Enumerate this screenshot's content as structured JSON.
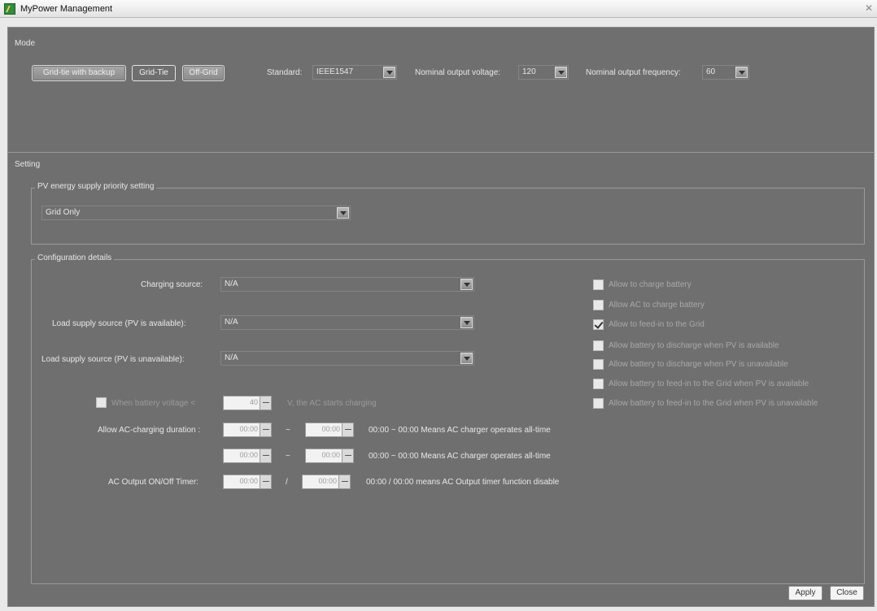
{
  "window": {
    "title": "MyPower Management"
  },
  "mode": {
    "section_title": "Mode",
    "buttons": [
      "Grid-tie with backup",
      "Grid-Tie",
      "Off-Grid"
    ],
    "standard_label": "Standard:",
    "standard_value": "IEEE1547",
    "voltage_label": "Nominal output voltage:",
    "voltage_value": "120",
    "frequency_label": "Nominal output frequency:",
    "frequency_value": "60"
  },
  "setting": {
    "section_title": "Setting",
    "pv_group": {
      "legend": "PV energy supply priority setting",
      "value": "Grid Only"
    },
    "config_group": {
      "legend": "Configuration details",
      "charging_source_label": "Charging source:",
      "charging_source_value": "N/A",
      "load_pv_available_label": "Load supply source (PV is available):",
      "load_pv_available_value": "N/A",
      "load_pv_unavailable_label": "Load supply source (PV is unavailable):",
      "load_pv_unavailable_value": "N/A",
      "battery_voltage_label": "When battery voltage <",
      "battery_voltage_value": "40",
      "battery_voltage_suffix": "V,  the AC starts charging",
      "ac_duration_label": "Allow AC-charging duration :",
      "time1_start": "00:00",
      "time1_end": "00:00",
      "time1_note": "00:00 ~ 00:00 Means AC charger operates all-time",
      "time2_start": "00:00",
      "time2_end": "00:00",
      "time2_note": "00:00 ~ 00:00 Means AC charger operates all-time",
      "dash1": "~",
      "dash2": "~",
      "ac_timer_label": "AC Output ON/Off Timer:",
      "timer_on": "00:00",
      "timer_off": "00:00",
      "slash": "/",
      "timer_note": "00:00 / 00:00 means AC Output timer function disable",
      "checkboxes": [
        {
          "label": "Allow to charge battery",
          "checked": false
        },
        {
          "label": "Allow AC to charge battery",
          "checked": false
        },
        {
          "label": "Allow to feed-in to the Grid",
          "checked": true
        },
        {
          "label": "Allow battery to discharge when PV is available",
          "checked": false
        },
        {
          "label": "Allow battery to discharge when PV is unavailable",
          "checked": false
        },
        {
          "label": "Allow battery to feed-in to the Grid when PV is available",
          "checked": false
        },
        {
          "label": "Allow battery to feed-in to the Grid when PV is unavailable",
          "checked": false
        }
      ]
    }
  },
  "footer": {
    "apply_label": "Apply",
    "close_label": "Close"
  },
  "colors": {
    "panel": "#6f6f6f",
    "titlebar": "#eeeeee",
    "text": "#e8e8e8",
    "disabled_text": "#a9a9a9"
  },
  "icons": {
    "app": "app-icon",
    "close": "close-icon",
    "dropdown": "chevron-down-icon"
  }
}
